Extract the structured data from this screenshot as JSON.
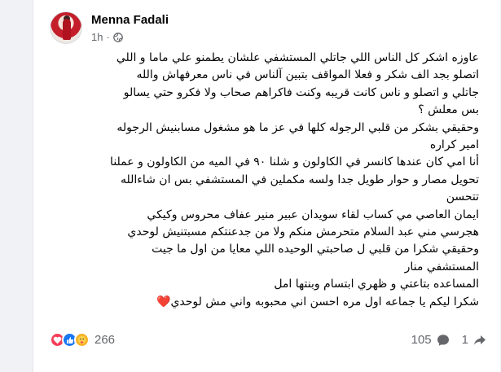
{
  "post": {
    "author": "Menna Fadali",
    "time": "1h",
    "privacy_icon": "globe-icon",
    "lines": [
      "عاوزه اشكر كل الناس اللي جاتلي المستشفي علشان يطمنو علي ماما و اللي",
      "اتصلو بجد الف شكر و فعلا المواقف بتبين آلناس في ناس معرفهاش والله",
      "جاتلي و اتصلو و ناس كانت قريبه وكنت فاكراهم صحاب ولا فكرو حتي يسالو",
      "بس معلش ؟",
      "وحقيقي بشكر من قلبي الرجوله كلها في عز ما هو مشغول مسابنيش الرجوله",
      "امير كراره",
      "أنا امي كان عندها كانسر في الكاولون و شلنا ٩٠ في الميه من الكاولون و عملنا",
      "تحويل مصار و حوار طويل جدا ولسه مكملين في المستشفي بس ان شاءالله",
      "تتحسن",
      "ايمان العاصي مي كساب لقاء سويدان عبير منير عفاف محروس وكيكي",
      "هجرسي مني عبد السلام  متحرمش منكم ولا من جدعنتكم مسبتنيش لوحدي",
      "وحقيقي شكرا من قلبي ل صاحبتي الوحيده اللي معايا من اول ما جيت",
      "المستشفي منار",
      "المساعده بتاعتي و ظهري ابتسام وبنتها امل",
      "شكرا ليكم يا جماعه اول مره احسن اني محبوبه واني مش لوحدي"
    ],
    "ending_emoji": "❤️"
  },
  "footer": {
    "reaction_icons": [
      "love-reaction-icon",
      "like-reaction-icon",
      "care-reaction-icon"
    ],
    "reaction_count": "266",
    "comment_count": "105",
    "share_count": "1"
  },
  "colors": {
    "text": "#050505",
    "secondary": "#65676b",
    "like": "#1877f2",
    "love": "#f33e58",
    "care": "#f7b125"
  }
}
